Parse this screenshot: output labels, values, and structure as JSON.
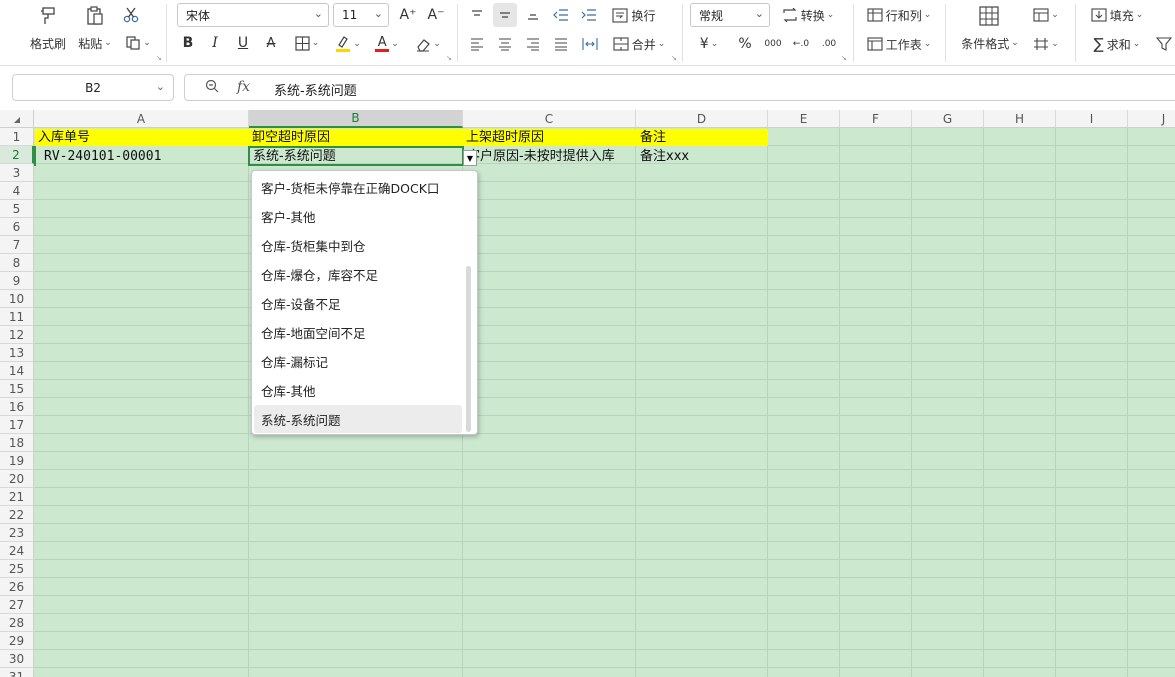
{
  "ribbon": {
    "clipboard": {
      "format_painter": "格式刷",
      "paste": "粘贴",
      "cut_icon": "scissors-icon",
      "copy_icon": "copy-icon"
    },
    "font": {
      "name": "宋体",
      "size": "11",
      "grow_icon": "A⁺",
      "shrink_icon": "A⁻"
    },
    "font_buttons": {
      "bold": "B",
      "italic": "I",
      "underline": "U",
      "strike": "A",
      "font_color_letter": "A"
    },
    "colors": {
      "highlight": "#ffd400",
      "font_color": "#e02020",
      "accent_green": "#2f8f46"
    },
    "alignment": {
      "wrap": "换行",
      "merge": "合并"
    },
    "number": {
      "format": "常规",
      "convert": "转换",
      "currency": "¥",
      "percent": "%",
      "thousands": "000"
    },
    "cells": {
      "row_col": "行和列",
      "worksheet": "工作表",
      "cond_format": "条件格式"
    },
    "editing": {
      "fill": "填充",
      "sum": "求和"
    }
  },
  "formula_bar": {
    "name_box": "B2",
    "fx_label": "fx",
    "value": "系统-系统问题"
  },
  "sheet": {
    "columns": [
      "A",
      "B",
      "C",
      "D",
      "E",
      "F",
      "G",
      "H",
      "I",
      "J"
    ],
    "rows": [
      "1",
      "2",
      "3",
      "4",
      "5",
      "6",
      "7",
      "8",
      "9",
      "10",
      "11",
      "12",
      "13",
      "14",
      "15",
      "16",
      "17",
      "18",
      "19",
      "20",
      "21",
      "22",
      "23",
      "24",
      "25",
      "26",
      "27",
      "28",
      "29",
      "30",
      "31"
    ],
    "selected_cell": "B2",
    "header_fill": "#ffff00",
    "cells": {
      "A1": "入库单号",
      "B1": "卸空超时原因",
      "C1": "上架超时原因",
      "D1": "备注",
      "A2": "RV-240101-00001",
      "B2": "系统-系统问题",
      "C2": "客户原因-未按时提供入库",
      "D2": "备注xxx"
    }
  },
  "dropdown": {
    "options": [
      "客户-货柜未停靠在正确DOCK口",
      "客户-其他",
      "仓库-货柜集中到仓",
      "仓库-爆仓，库容不足",
      "仓库-设备不足",
      "仓库-地面空间不足",
      "仓库-漏标记",
      "仓库-其他",
      "系统-系统问题"
    ],
    "highlighted": "系统-系统问题"
  }
}
